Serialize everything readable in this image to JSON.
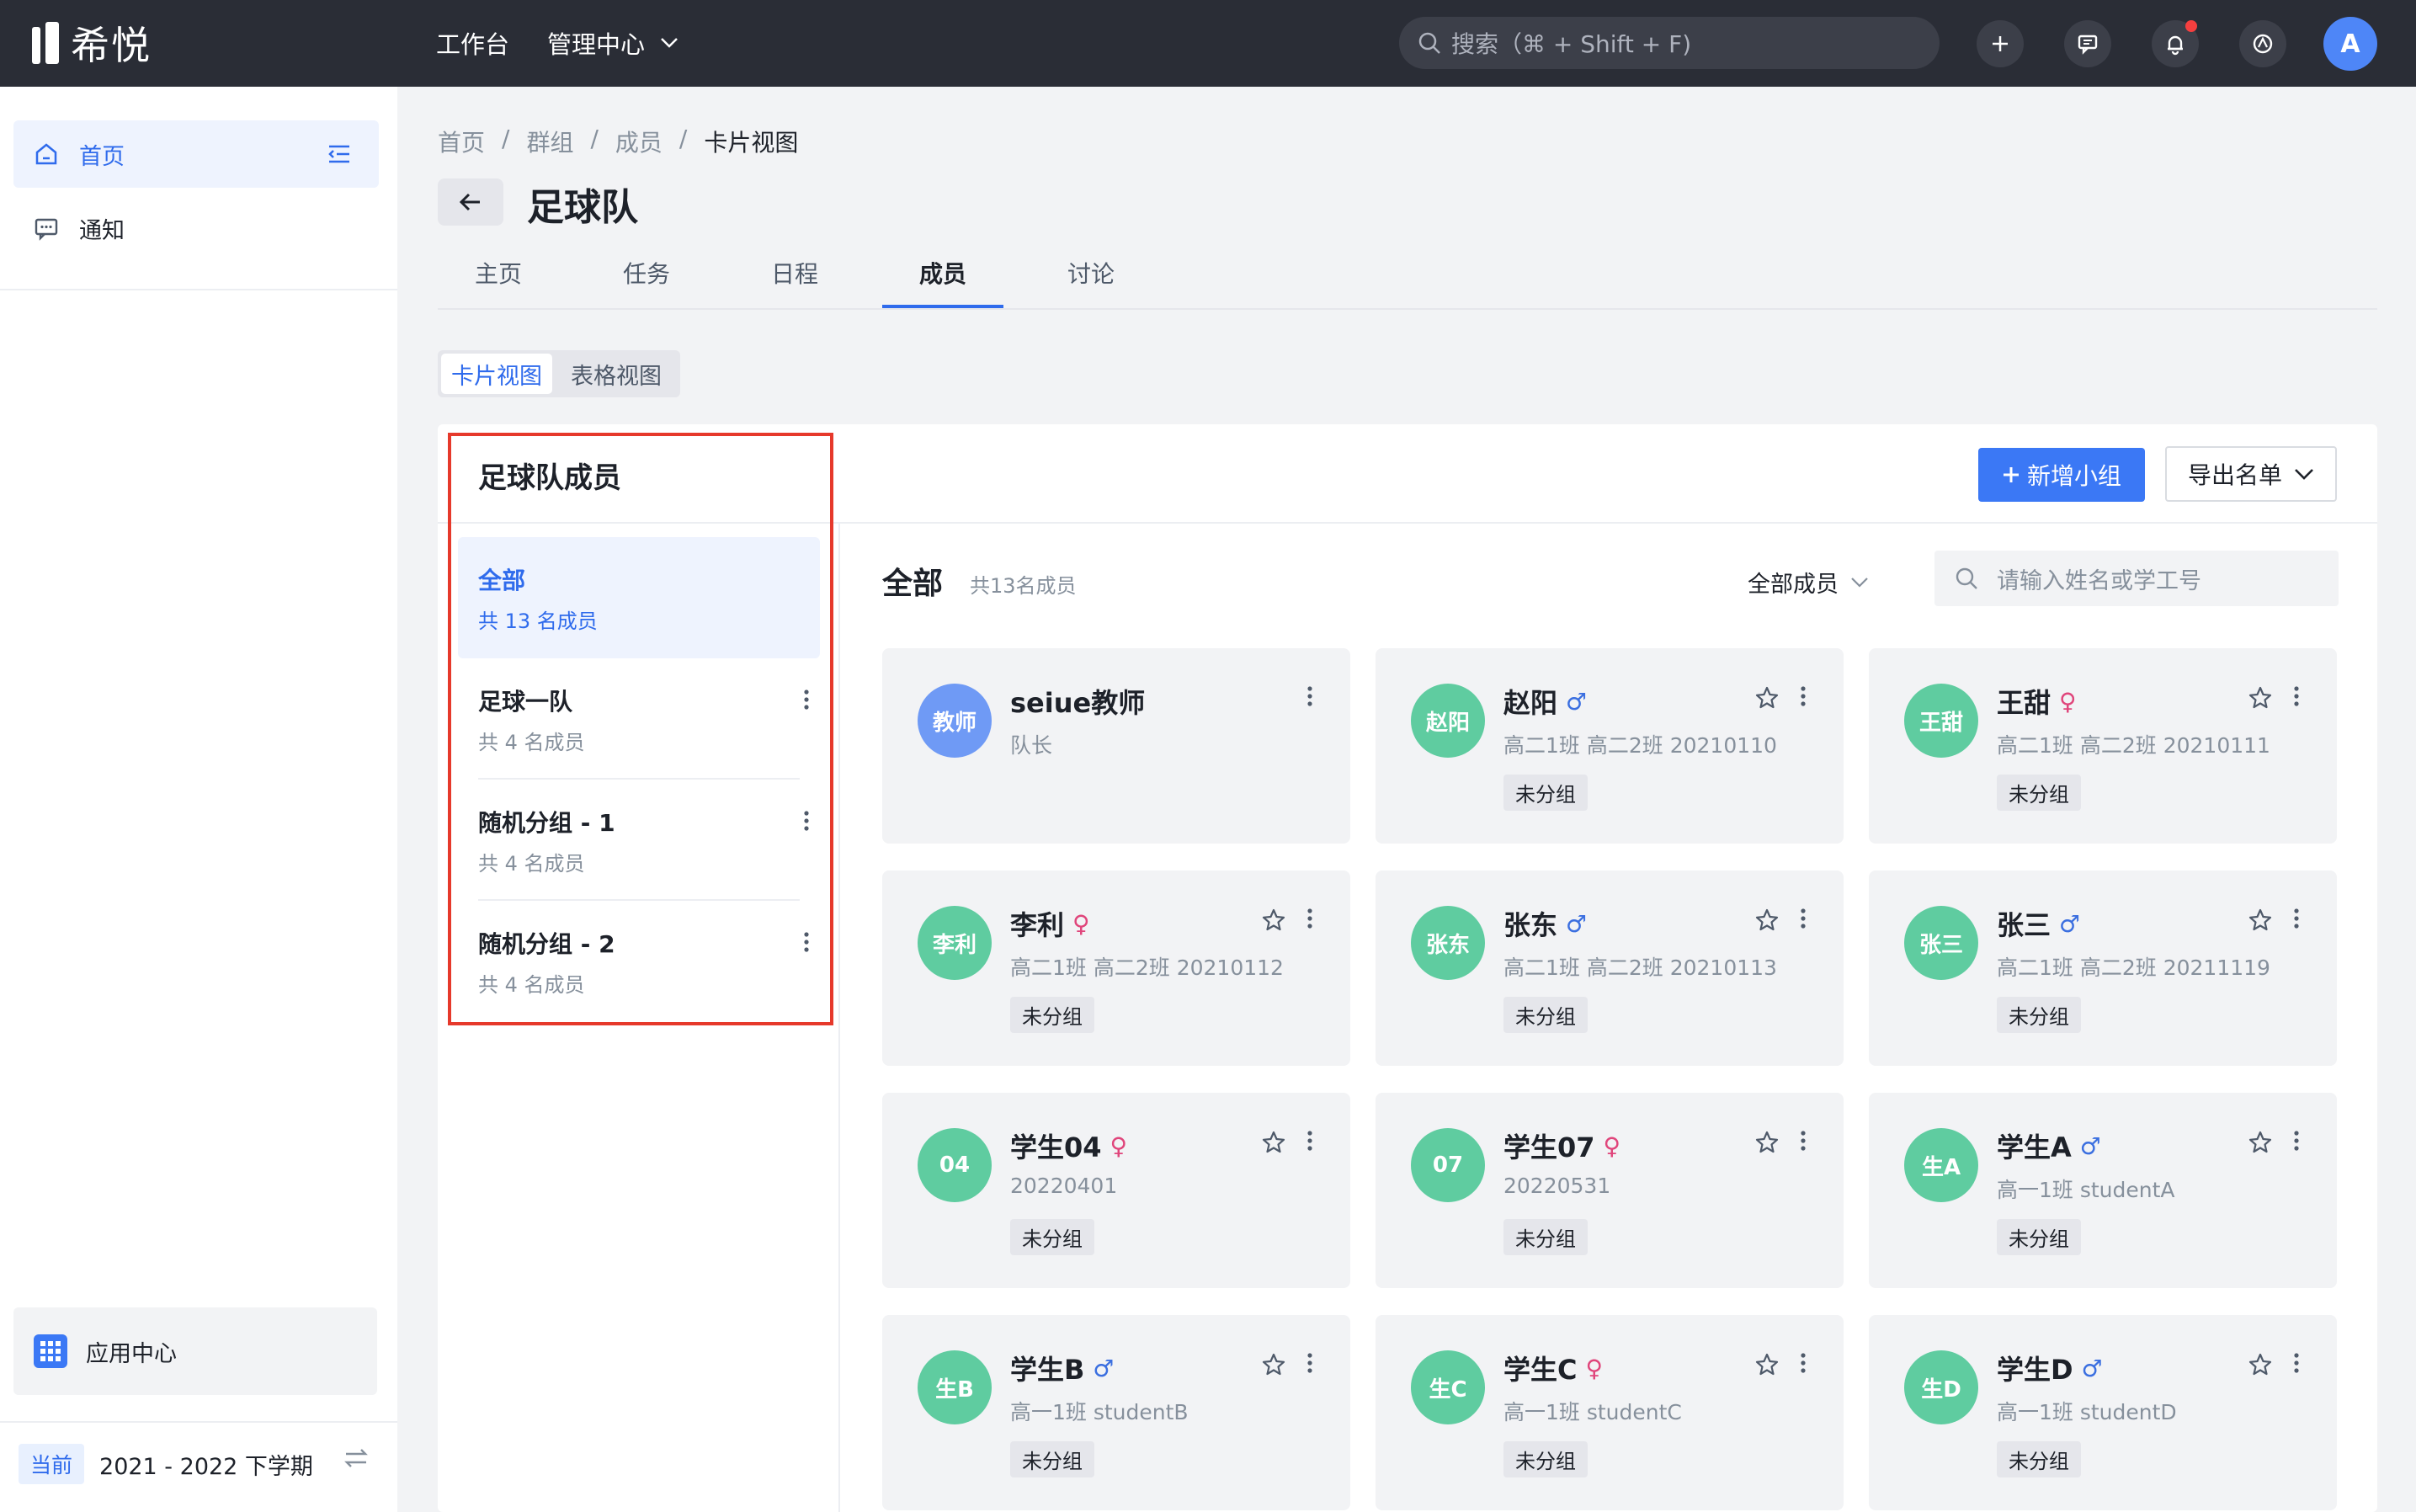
{
  "topbar": {
    "logo_text": "希悦",
    "nav": [
      {
        "label": "工作台"
      },
      {
        "label": "管理中心"
      }
    ],
    "search_placeholder": "搜索（⌘ + Shift + F)",
    "avatar_letter": "A"
  },
  "sidebar": {
    "items": [
      {
        "label": "首页",
        "icon": "home-icon"
      },
      {
        "label": "通知",
        "icon": "message-icon"
      }
    ],
    "app_center": "应用中心",
    "term_tag": "当前",
    "term_label": "2021 - 2022 下学期"
  },
  "breadcrumb": [
    "首页",
    "群组",
    "成员",
    "卡片视图"
  ],
  "page_title": "足球队",
  "tabs": [
    {
      "label": "主页"
    },
    {
      "label": "任务"
    },
    {
      "label": "日程"
    },
    {
      "label": "成员"
    },
    {
      "label": "讨论"
    }
  ],
  "active_tab": "成员",
  "view_toggle": {
    "card": "卡片视图",
    "table": "表格视图"
  },
  "panel": {
    "title": "足球队成员",
    "add_group_button": "新增小组",
    "export_button": "导出名单",
    "groups": [
      {
        "name": "全部",
        "count": "共 13 名成员"
      },
      {
        "name": "足球一队",
        "count": "共 4 名成员"
      },
      {
        "name": "随机分组 - 1",
        "count": "共 4 名成员"
      },
      {
        "name": "随机分组 - 2",
        "count": "共 4 名成员"
      }
    ],
    "content_title": "全部",
    "content_count": "共13名成员",
    "filter_label": "全部成员",
    "search_placeholder": "请输入姓名或学工号"
  },
  "members": [
    {
      "avatar": "教师",
      "name": "seiue教师",
      "gender": "",
      "sub": "队长",
      "tag": "",
      "color": "#6f9af5"
    },
    {
      "avatar": "赵阳",
      "name": "赵阳",
      "gender": "♂",
      "sub": "高二1班 高二2班 20210110",
      "tag": "未分组",
      "color": "#5fcca0"
    },
    {
      "avatar": "王甜",
      "name": "王甜",
      "gender": "♀",
      "sub": "高二1班 高二2班 20210111",
      "tag": "未分组",
      "color": "#5fcca0"
    },
    {
      "avatar": "李利",
      "name": "李利",
      "gender": "♀",
      "sub": "高二1班 高二2班 20210112",
      "tag": "未分组",
      "color": "#5fcca0"
    },
    {
      "avatar": "张东",
      "name": "张东",
      "gender": "♂",
      "sub": "高二1班 高二2班 20210113",
      "tag": "未分组",
      "color": "#5fcca0"
    },
    {
      "avatar": "张三",
      "name": "张三",
      "gender": "♂",
      "sub": "高二1班 高二2班 20211119",
      "tag": "未分组",
      "color": "#5fcca0"
    },
    {
      "avatar": "04",
      "name": "学生04",
      "gender": "♀",
      "sub": "20220401",
      "tag": "未分组",
      "color": "#5fcca0"
    },
    {
      "avatar": "07",
      "name": "学生07",
      "gender": "♀",
      "sub": "20220531",
      "tag": "未分组",
      "color": "#5fcca0"
    },
    {
      "avatar": "生A",
      "name": "学生A",
      "gender": "♂",
      "sub": "高一1班 studentA",
      "tag": "未分组",
      "color": "#5fcca0"
    },
    {
      "avatar": "生B",
      "name": "学生B",
      "gender": "♂",
      "sub": "高一1班 studentB",
      "tag": "未分组",
      "color": "#5fcca0"
    },
    {
      "avatar": "生C",
      "name": "学生C",
      "gender": "♀",
      "sub": "高一1班 studentC",
      "tag": "未分组",
      "color": "#5fcca0"
    },
    {
      "avatar": "生D",
      "name": "学生D",
      "gender": "♂",
      "sub": "高一1班 studentD",
      "tag": "未分组",
      "color": "#5fcca0"
    }
  ],
  "colors": {
    "accent": "#2f6bec",
    "male": "#3b6fe0",
    "female": "#e0457b",
    "highlight": "#e6392b"
  }
}
